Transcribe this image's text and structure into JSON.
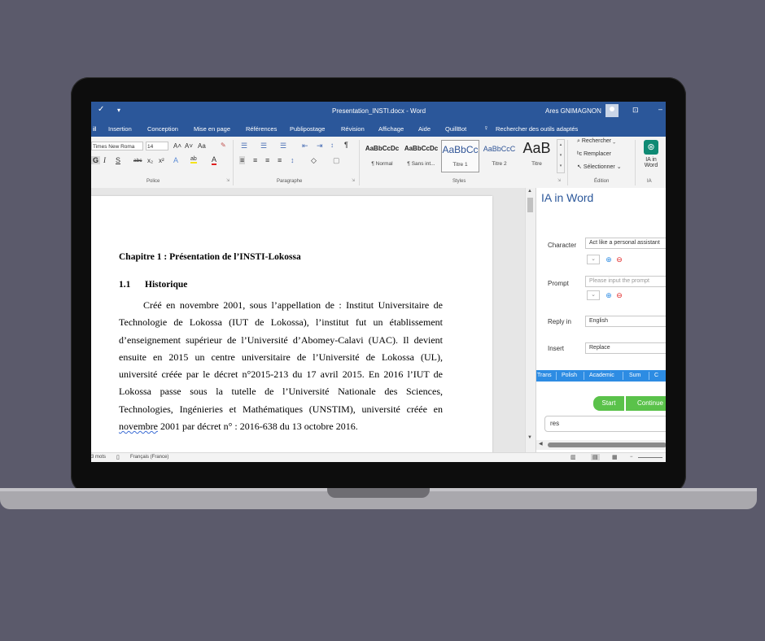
{
  "window": {
    "title": "Presentation_INSTI.docx - Word",
    "user": "Ares GNIMAGNON",
    "qat_glyph": "✓"
  },
  "ribbon_tabs": [
    "il",
    "Insertion",
    "Conception",
    "Mise en page",
    "Références",
    "Publipostage",
    "Révision",
    "Affichage",
    "Aide",
    "QuillBot"
  ],
  "tell_me": "Rechercher des outils adaptés",
  "font": {
    "name": "Times New Roma",
    "size": "14",
    "row1_buttons": [
      "A˄",
      "A˅",
      "Aa",
      "✎"
    ],
    "row2_buttons": [
      "G",
      "I",
      "S",
      "abc",
      "x₂",
      "x²",
      "A",
      "ab",
      "A"
    ],
    "group_label": "Police"
  },
  "paragraph": {
    "group_label": "Paragraphe"
  },
  "styles": {
    "items": [
      {
        "preview": "AaBbCcDc",
        "label": "¶ Normal"
      },
      {
        "preview": "AaBbCcDc",
        "label": "¶ Sans int..."
      },
      {
        "preview": "AaBbCc",
        "label": "Titre 1"
      },
      {
        "preview": "AaBbCcC",
        "label": "Titre 2"
      },
      {
        "preview": "AaB",
        "label": "Titre"
      }
    ],
    "group_label": "Styles"
  },
  "editing": {
    "find": "Rechercher",
    "replace": "Remplacer",
    "select": "Sélectionner",
    "group_label": "Édition"
  },
  "ia": {
    "button_line1": "IA in",
    "button_line2": "Word",
    "group_label": "IA"
  },
  "document": {
    "chapter_title": "Chapitre 1 : Présentation de l’INSTI-Lokossa",
    "section_number": "1.1",
    "section_title": "Historique",
    "lines": [
      "Créé en novembre 2001, sous l’appellation de : Institut Universitaire de",
      "Technologie de Lokossa (IUT de Lokossa), l’institut fut un établissement",
      "d’enseignement supérieur de l’Université d’Abomey-Calavi (UAC). Il devient",
      "ensuite en 2015 un centre universitaire de l’Université de Lokossa (UL),",
      "université créée par le décret n°2015-213 du 17 avril 2015. En 2016 l’IUT de",
      "Lokossa passe sous la tutelle de l’Université Nationale des Sciences,",
      "Technologies, Ingénieries et Mathématiques (UNSTIM), université créée en"
    ],
    "last_line_underlined": "novembre",
    "last_line_rest": " 2001 par décret n° : 2016-638 du 13 octobre 2016."
  },
  "pane": {
    "title": "IA in Word",
    "character_label": "Character",
    "character_value": "Act like a personal assistant",
    "prompt_label": "Prompt",
    "prompt_placeholder": "Please input the prompt",
    "reply_label": "Reply in",
    "reply_value": "English",
    "insert_label": "Insert",
    "insert_value": "Replace",
    "tabs": [
      "Trans",
      "Polish",
      "Academic",
      "Sum",
      "C"
    ],
    "start": "Start",
    "continue": "Continue",
    "result": "res"
  },
  "status": {
    "words": "3 mots",
    "language": "Français (France)",
    "zoom_minus": "−"
  },
  "colors": {
    "word_blue": "#2b579a",
    "green_button": "#5ac24a",
    "tab_blue": "#2d8ce3"
  }
}
